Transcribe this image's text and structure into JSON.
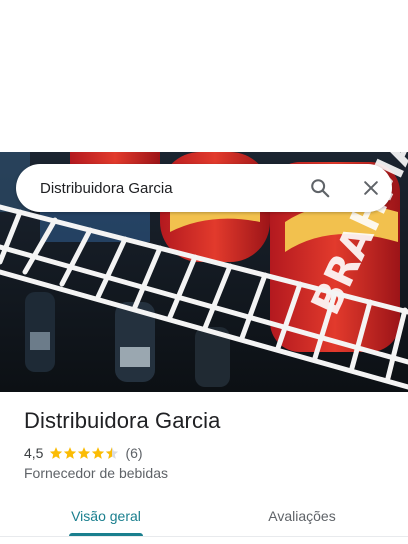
{
  "search": {
    "value": "Distribuidora Garcia",
    "search_icon": "search-icon",
    "close_icon": "close-icon"
  },
  "hero": {
    "description_icon": "photo"
  },
  "place": {
    "name": "Distribuidora Garcia",
    "rating_value": "4,5",
    "rating": 4.5,
    "rating_max": 5,
    "review_count": "(6)",
    "category": "Fornecedor de bebidas"
  },
  "tabs": [
    {
      "label": "Visão geral",
      "selected": true
    },
    {
      "label": "Avaliações",
      "selected": false
    }
  ],
  "colors": {
    "accent": "#1a7f8e",
    "star": "#fbbc04",
    "text_primary": "#202124",
    "text_secondary": "#5f6368"
  }
}
